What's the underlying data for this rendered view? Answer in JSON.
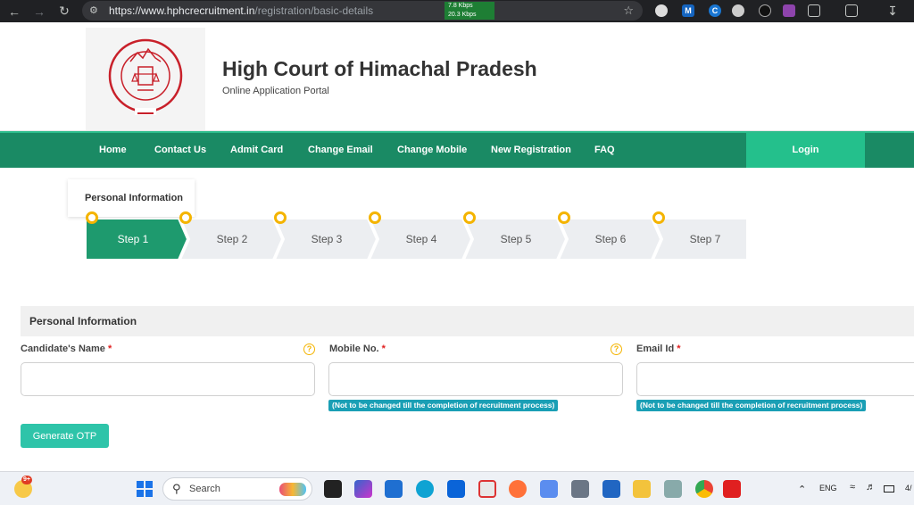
{
  "browser": {
    "url_host": "https://www.hphcrecruitment.in",
    "url_path": "/registration/basic-details",
    "speed_down": "7.8 Kbps",
    "speed_up": "20.3 Kbps",
    "extension_m": "M",
    "extension_c": "C"
  },
  "header": {
    "title": "High Court of Himachal Pradesh",
    "subtitle": "Online Application Portal"
  },
  "nav": {
    "items": [
      "Home",
      "Contact Us",
      "Admit Card",
      "Change Email",
      "Change Mobile",
      "New Registration",
      "FAQ"
    ],
    "login": "Login"
  },
  "tab": {
    "label": "Personal Information"
  },
  "steps": {
    "labels": [
      "Step 1",
      "Step 2",
      "Step 3",
      "Step 4",
      "Step 5",
      "Step 6",
      "Step 7"
    ],
    "active_index": 0,
    "active_color": "#1e9a6e",
    "inactive_color": "#eceef1",
    "dot_color": "#f4b400"
  },
  "form": {
    "section_title": "Personal Information",
    "fields": [
      {
        "label": "Candidate's Name",
        "required": "*",
        "help": "?",
        "value": "",
        "note": ""
      },
      {
        "label": "Mobile No.",
        "required": "*",
        "help": "?",
        "value": "",
        "note": "(Not to be changed till the completion of recruitment process)"
      },
      {
        "label": "Email Id",
        "required": "*",
        "value": "",
        "note": "(Not to be changed till the completion of recruitment process)"
      }
    ],
    "otp_button": "Generate OTP"
  },
  "taskbar": {
    "notification_badge": "9+",
    "search_placeholder": "Search",
    "language": "ENG",
    "clock_fragment": "4/"
  },
  "colors": {
    "nav_green": "#1a8a64",
    "login_green": "#24c08c",
    "otp_teal": "#2ec4a9",
    "note_blue": "#1a9fb5",
    "required_red": "#e02020"
  }
}
